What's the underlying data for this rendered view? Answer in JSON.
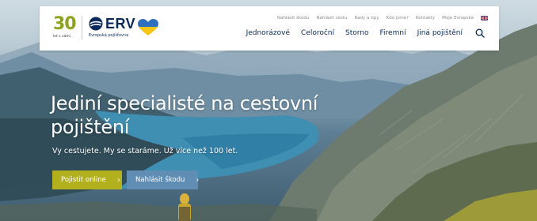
{
  "header": {
    "logo_30": {
      "number": "30",
      "subtitle": "let s vámi"
    },
    "logo_erv": {
      "name": "ERV",
      "subtitle": "Evropská pojišťovna"
    },
    "top_links": [
      "Nahlásit škodu",
      "Nahlásit cestu",
      "Rady a tipy",
      "Kdo jsme?",
      "Kontakty",
      "Moje Evropská"
    ],
    "main_nav": [
      "Jednorázové",
      "Celoroční",
      "Storno",
      "Firemní",
      "Jiná pojištění"
    ],
    "icons": {
      "language": "uk-flag-icon",
      "search": "search-icon",
      "support": "ukraine-heart-icon"
    }
  },
  "hero": {
    "headline": "Jediní specialisté na cestovní pojištění",
    "tagline": "Vy cestujete. My se staráme. Už více než 100 let.",
    "primary_button": "Pojistit online",
    "secondary_button": "Nahlásit škodu"
  },
  "colors": {
    "brand_green": "#8fa21c",
    "brand_navy": "#0a2a5c",
    "primary_button": "#b3b01d",
    "secondary_button": "#5f8db4"
  }
}
